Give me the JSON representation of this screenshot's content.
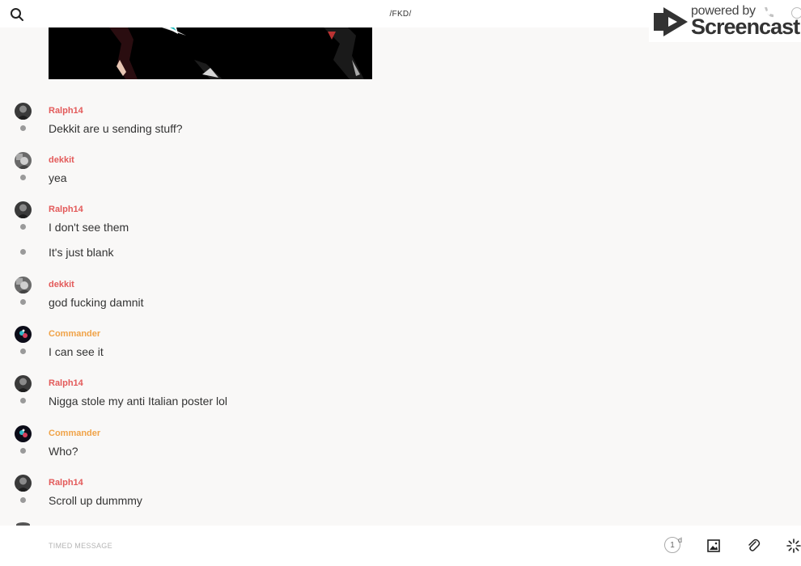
{
  "header": {
    "title": "/FKD/",
    "search_icon": "search-icon"
  },
  "watermark": {
    "small": "powered by",
    "big": "Screencastify"
  },
  "messages": [
    {
      "author": "Ralph14",
      "author_color": "#e35a5a",
      "avatar": "avatar-ralph14",
      "lines": [
        "Dekkit are u sending stuff?"
      ]
    },
    {
      "author": "dekkit",
      "author_color": "#e35a5a",
      "avatar": "avatar-dekkit",
      "lines": [
        "yea"
      ]
    },
    {
      "author": "Ralph14",
      "author_color": "#e35a5a",
      "avatar": "avatar-ralph14",
      "lines": [
        "I don't see them",
        "It's just blank"
      ]
    },
    {
      "author": "dekkit",
      "author_color": "#e35a5a",
      "avatar": "avatar-dekkit",
      "lines": [
        "god fucking damnit"
      ]
    },
    {
      "author": "Commander",
      "author_color": "#f0a348",
      "avatar": "avatar-commander",
      "lines": [
        "I can see it"
      ]
    },
    {
      "author": "Ralph14",
      "author_color": "#e35a5a",
      "avatar": "avatar-ralph14",
      "lines": [
        "Nigga stole my anti Italian poster lol"
      ]
    },
    {
      "author": "Commander",
      "author_color": "#f0a348",
      "avatar": "avatar-commander",
      "lines": [
        "Who?"
      ]
    },
    {
      "author": "Ralph14",
      "author_color": "#e35a5a",
      "avatar": "avatar-ralph14",
      "lines": [
        "Scroll up dummmy"
      ]
    }
  ],
  "composer": {
    "placeholder": "TIMED MESSAGE",
    "timer_value": "1",
    "timer_unit": "d",
    "icons": [
      "timer-icon",
      "image-icon",
      "attachment-icon",
      "loading-icon"
    ]
  }
}
